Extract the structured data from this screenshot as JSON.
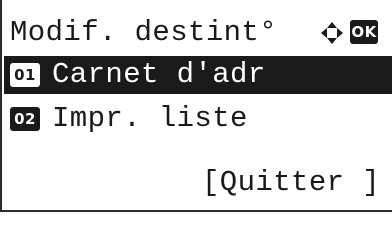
{
  "title": "Modif. destint°",
  "icons": {
    "nav": "four-way-arrow-icon",
    "ok_key": "ok-key-icon"
  },
  "ok_key_label": "OK",
  "menu": {
    "items": [
      {
        "number": "01",
        "label": "Carnet d'adr",
        "selected": true
      },
      {
        "number": "02",
        "label": "Impr. liste",
        "selected": false
      }
    ]
  },
  "softkey": {
    "label": "[Quitter ]"
  },
  "colors": {
    "foreground": "#1a1a1a",
    "background": "#ffffff"
  }
}
